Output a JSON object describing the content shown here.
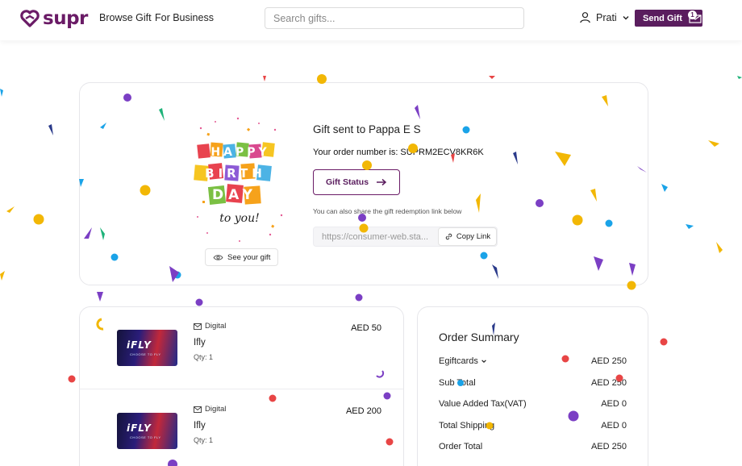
{
  "header": {
    "brand": "supr",
    "nav": [
      "Browse Gift",
      "For Business"
    ],
    "search_placeholder": "Search gifts...",
    "user_name": "Prati",
    "send_gift_label": "Send Gift",
    "cart_count": "1"
  },
  "gift": {
    "title": "Gift sent to Pappa E S",
    "order_number": "Your order number is: SUPRM2ECV8KR6K",
    "status_label": "Gift Status",
    "share_note": "You can also share the gift redemption link below",
    "link_value": "https://consumer-web.sta...",
    "copy_label": "Copy Link",
    "see_gift_label": "See your gift",
    "card_text": {
      "line1": "HAPPY",
      "line2": "BIRTH",
      "line3": "DAY",
      "line4": "to you!"
    }
  },
  "items": [
    {
      "type": "Digital",
      "name": "Ifly",
      "qty": "Qty: 1",
      "price": "AED 50",
      "logo": "iFLY",
      "tagline": "CHOOSE TO FLY"
    },
    {
      "type": "Digital",
      "name": "Ifly",
      "qty": "Qty: 1",
      "price": "AED 200",
      "logo": "iFLY",
      "tagline": "CHOOSE TO FLY"
    }
  ],
  "summary": {
    "title": "Order Summary",
    "rows": [
      {
        "label": "Egiftcards",
        "value": "AED 250"
      },
      {
        "label": "Sub Total",
        "value": "AED 250"
      },
      {
        "label": "Value Added Tax(VAT)",
        "value": "AED 0"
      },
      {
        "label": "Total Shipping",
        "value": "AED 0"
      },
      {
        "label": "Order Total",
        "value": "AED 250"
      }
    ]
  },
  "colors": {
    "brand": "#5a1d5e",
    "confetti": [
      "#f2b705",
      "#7b3fc4",
      "#1aa3e8",
      "#e84545",
      "#1fb37a"
    ]
  }
}
